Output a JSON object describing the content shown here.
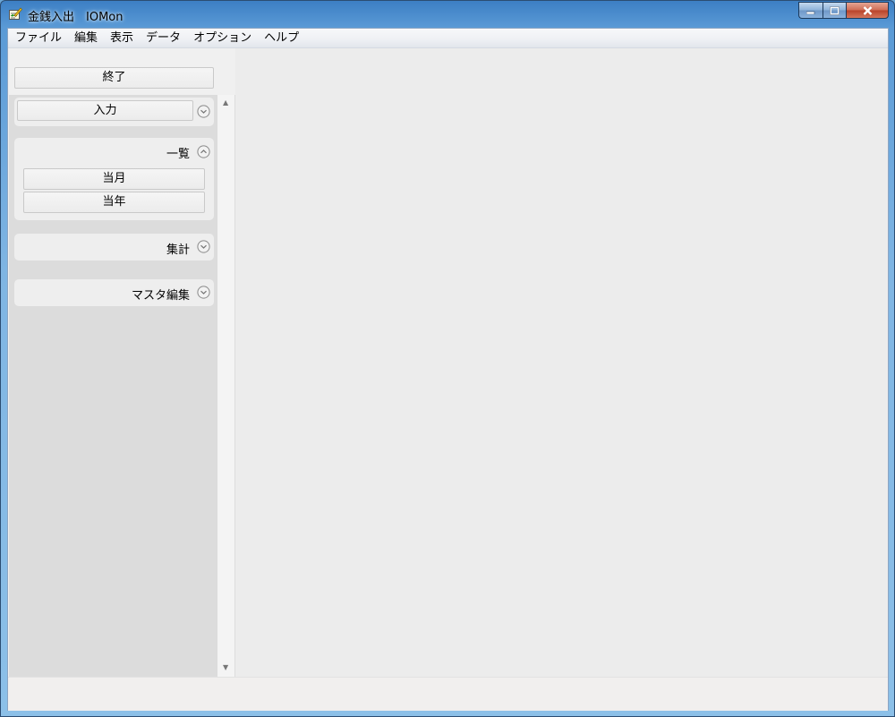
{
  "window": {
    "title": "金銭入出　IOMon",
    "controls": {
      "minimize_icon": "minimize-icon",
      "maximize_icon": "maximize-icon",
      "close_icon": "close-icon"
    }
  },
  "menubar": {
    "items": [
      "ファイル",
      "編集",
      "表示",
      "データ",
      "オプション",
      "ヘルプ"
    ]
  },
  "sidebar": {
    "exit_label": "終了",
    "groups": [
      {
        "title": "",
        "buttons": [
          "入力"
        ],
        "state": "collapsed"
      },
      {
        "title": "一覧",
        "buttons": [
          "当月",
          "当年"
        ],
        "state": "expanded"
      },
      {
        "title": "集計",
        "buttons": [],
        "state": "collapsed"
      },
      {
        "title": "マスタ編集",
        "buttons": [],
        "state": "collapsed"
      }
    ]
  },
  "colors": {
    "titlebar": "#5a9ad6",
    "client_bg": "#f0f0f0",
    "sidebar_bg": "#dcdcdc",
    "group_bg": "#eeeeee"
  }
}
